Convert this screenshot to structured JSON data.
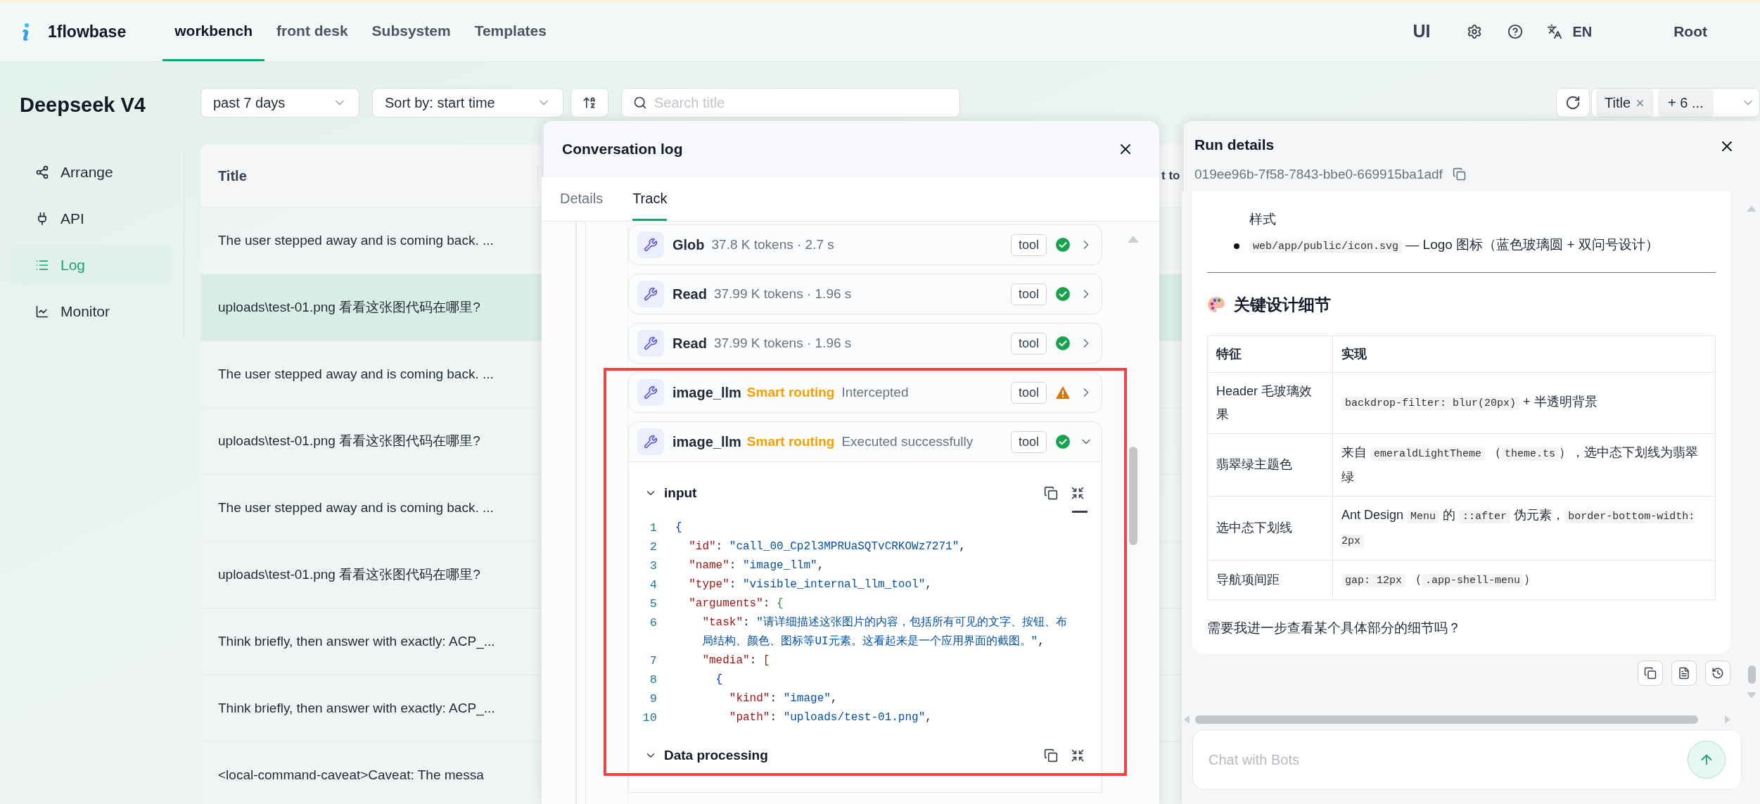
{
  "header": {
    "brand": "1flowbase",
    "nav": [
      {
        "label": "workbench",
        "selected": true
      },
      {
        "label": "front desk",
        "selected": false
      },
      {
        "label": "Subsystem",
        "selected": false
      },
      {
        "label": "Templates",
        "selected": false
      }
    ],
    "ui_label": "UI",
    "language": "EN",
    "user": "Root"
  },
  "sidebar": {
    "title": "Deepseek V4",
    "items": [
      {
        "label": "Arrange",
        "selected": false
      },
      {
        "label": "API",
        "selected": false
      },
      {
        "label": "Log",
        "selected": true
      },
      {
        "label": "Monitor",
        "selected": false
      }
    ]
  },
  "toolbar": {
    "period": "past 7 days",
    "sort": "Sort by: start time",
    "search": {
      "placeholder": "Search title"
    },
    "column_tags": [
      "Title"
    ],
    "more_tag": "+ 6 ..."
  },
  "table": {
    "columns": [
      "Title",
      "t to"
    ],
    "rows": [
      {
        "title": "The user stepped away and is coming back. ...",
        "selected": false
      },
      {
        "title": "uploads\\test-01.png 看看这张图代码在哪里?",
        "selected": true
      },
      {
        "title": "The user stepped away and is coming back. ...",
        "selected": false
      },
      {
        "title": "uploads\\test-01.png 看看这张图代码在哪里?",
        "selected": false
      },
      {
        "title": "The user stepped away and is coming back. ...",
        "selected": false
      },
      {
        "title": "uploads\\test-01.png 看看这张图代码在哪里?",
        "selected": false
      },
      {
        "title": "Think briefly, then answer with exactly: ACP_...",
        "selected": false
      },
      {
        "title": "Think briefly, then answer with exactly: ACP_...",
        "selected": false
      },
      {
        "title": "<local-command-caveat>Caveat: The messa",
        "selected": false
      }
    ]
  },
  "conversation_log": {
    "title": "Conversation log",
    "tabs": [
      {
        "label": "Details",
        "selected": false
      },
      {
        "label": "Track",
        "selected": true
      }
    ],
    "steps": [
      {
        "name": "Glob",
        "meta": "37.8 K tokens · 2.7 s",
        "tag": "tool",
        "kind": "success",
        "expanded": false
      },
      {
        "name": "Read",
        "meta": "37.99 K tokens · 1.96 s",
        "tag": "tool",
        "kind": "success",
        "expanded": false
      },
      {
        "name": "Read",
        "meta": "37.99 K tokens · 1.96 s",
        "tag": "tool",
        "kind": "success",
        "expanded": false
      },
      {
        "name": "image_llm",
        "routing": "Smart routing",
        "meta": "Intercepted",
        "tag": "tool",
        "kind": "warning",
        "expanded": false
      },
      {
        "name": "image_llm",
        "routing": "Smart routing",
        "meta": "Executed successfully",
        "tag": "tool",
        "kind": "success",
        "expanded": true
      }
    ],
    "sections": [
      {
        "title": "input",
        "expanded": true,
        "lines": [
          {
            "number": "1",
            "parts": [
              {
                "kind": "bracket1",
                "text": "{"
              }
            ]
          },
          {
            "number": "2",
            "parts": [
              {
                "kind": "key",
                "text": "  \"id\""
              },
              {
                "kind": "punct",
                "text": ": "
              },
              {
                "kind": "string",
                "text": "\"call_00_Cp2l3MPRUaSQTvCRKOWz7271\""
              },
              {
                "kind": "punct",
                "text": ","
              }
            ]
          },
          {
            "number": "3",
            "parts": [
              {
                "kind": "key",
                "text": "  \"name\""
              },
              {
                "kind": "punct",
                "text": ": "
              },
              {
                "kind": "string",
                "text": "\"image_llm\""
              },
              {
                "kind": "punct",
                "text": ","
              }
            ]
          },
          {
            "number": "4",
            "parts": [
              {
                "kind": "key",
                "text": "  \"type\""
              },
              {
                "kind": "punct",
                "text": ": "
              },
              {
                "kind": "string",
                "text": "\"visible_internal_llm_tool\""
              },
              {
                "kind": "punct",
                "text": ","
              }
            ]
          },
          {
            "number": "5",
            "parts": [
              {
                "kind": "key",
                "text": "  \"arguments\""
              },
              {
                "kind": "punct",
                "text": ": "
              },
              {
                "kind": "bracket2",
                "text": "{"
              }
            ]
          },
          {
            "number": "6",
            "parts": [
              {
                "kind": "key",
                "text": "    \"task\""
              },
              {
                "kind": "punct",
                "text": ": "
              },
              {
                "kind": "string",
                "text": "\"请详细描述这张图片的内容，包括所有可见的文字、按钮、布局结构、颜色、图标等UI元素。这看起来是一个应用界面的截图。\""
              },
              {
                "kind": "punct",
                "text": ","
              }
            ]
          },
          {
            "number": "7",
            "parts": [
              {
                "kind": "key",
                "text": "    \"media\""
              },
              {
                "kind": "punct",
                "text": ": "
              },
              {
                "kind": "bracket3",
                "text": "["
              }
            ]
          },
          {
            "number": "8",
            "parts": [
              {
                "kind": "bracket1",
                "text": "      {"
              }
            ]
          },
          {
            "number": "9",
            "parts": [
              {
                "kind": "key",
                "text": "        \"kind\""
              },
              {
                "kind": "punct",
                "text": ": "
              },
              {
                "kind": "string",
                "text": "\"image\""
              },
              {
                "kind": "punct",
                "text": ","
              }
            ]
          },
          {
            "number": "10",
            "parts": [
              {
                "kind": "key",
                "text": "        \"path\""
              },
              {
                "kind": "punct",
                "text": ": "
              },
              {
                "kind": "string",
                "text": "\"uploads/test-01.png\""
              },
              {
                "kind": "punct",
                "text": ","
              }
            ]
          }
        ]
      },
      {
        "title": "Data processing",
        "expanded": true
      }
    ]
  },
  "run_details": {
    "title": "Run details",
    "run_id": "019ee96b-7f58-7843-bbe0-669915ba1adf",
    "continuation": "样式",
    "bullets": [
      [
        {
          "kind": "code",
          "text": "web/app/public/icon.svg"
        },
        {
          "kind": "text",
          "text": " — Logo 图标（蓝色玻璃圆 + 双问号设计）"
        }
      ]
    ],
    "heading": "关键设计细节",
    "table": {
      "columns": [
        "特征",
        "实现"
      ],
      "rows": [
        {
          "feature": "Header 毛玻璃效果",
          "implementation": [
            {
              "kind": "code",
              "text": "backdrop-filter: blur(20px)"
            },
            {
              "kind": "text",
              "text": " + 半透明背景"
            }
          ]
        },
        {
          "feature": "翡翠绿主题色",
          "implementation": [
            {
              "kind": "text",
              "text": "来自 "
            },
            {
              "kind": "code",
              "text": "emeraldLightTheme"
            },
            {
              "kind": "text",
              "text": " （"
            },
            {
              "kind": "code",
              "text": "theme.ts"
            },
            {
              "kind": "text",
              "text": "），选中态下划线为翡翠绿"
            }
          ]
        },
        {
          "feature": "选中态下划线",
          "implementation": [
            {
              "kind": "text",
              "text": "Ant Design "
            },
            {
              "kind": "code",
              "text": "Menu"
            },
            {
              "kind": "text",
              "text": " 的 "
            },
            {
              "kind": "code",
              "text": "::after"
            },
            {
              "kind": "text",
              "text": " 伪元素，"
            },
            {
              "kind": "code",
              "text": "border-bottom-width: 2px"
            }
          ]
        },
        {
          "feature": "导航项间距",
          "implementation": [
            {
              "kind": "code",
              "text": "gap: 12px"
            },
            {
              "kind": "text",
              "text": " （"
            },
            {
              "kind": "code",
              "text": ".app-shell-menu"
            },
            {
              "kind": "text",
              "text": "）"
            }
          ]
        }
      ]
    },
    "closing": "需要我进一步查看某个具体部分的细节吗？",
    "chat": {
      "placeholder": "Chat with Bots"
    }
  }
}
